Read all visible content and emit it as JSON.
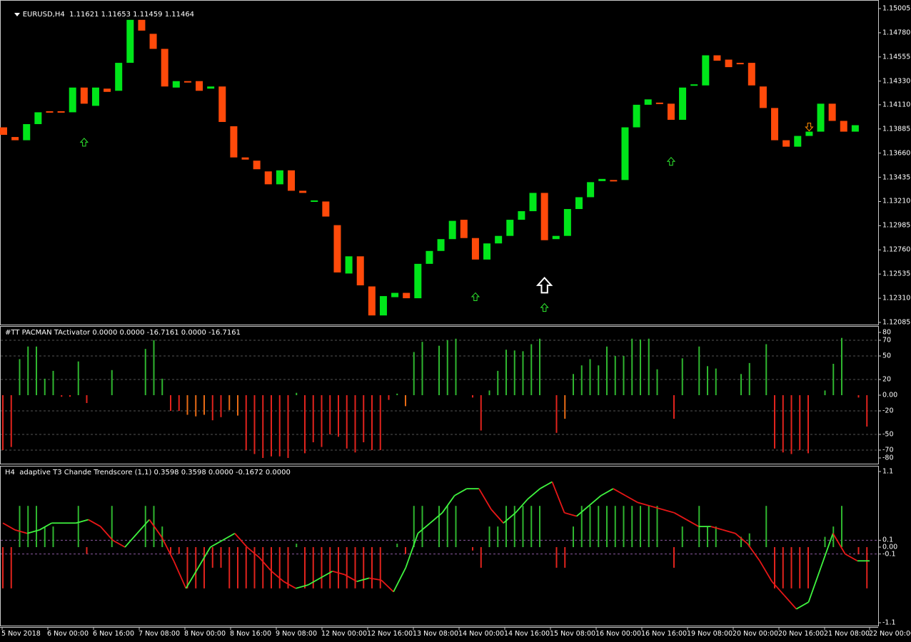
{
  "main_label": {
    "symbol": "EURUSD,H4",
    "ohlc": "1.11621 1.11653 1.11459 1.11464"
  },
  "pacman_label": "#TT PACMAN TActivator 0.0000 0.0000 -16.7161 0.0000 -16.7161",
  "t3_label": "H4  adaptive T3 Chande Trendscore (1,1) 0.3598 0.3598 0.0000 -0.1672 0.0000",
  "colors": {
    "bull": "#00e61a",
    "bear": "#ff4a0a",
    "hist_up": "#2fb62f",
    "hist_down": "#e1231d",
    "hist_orange": "#e86b15",
    "line_up": "#3ff43f",
    "line_down": "#e81717",
    "grid": "#2d2d2d",
    "pane_border": "#c8c8c8"
  },
  "price_axis_ticks": [
    "1.15005",
    "1.14780",
    "1.14555",
    "1.14330",
    "1.14110",
    "1.13885",
    "1.13660",
    "1.13435",
    "1.13210",
    "1.12985",
    "1.12760",
    "1.12535",
    "1.12310",
    "1.12085"
  ],
  "pacman_axis_ticks": [
    "80",
    "70",
    "50",
    "20",
    "0.00",
    "-20",
    "-50",
    "-70",
    "-80"
  ],
  "t3_axis_ticks": [
    "1.1",
    "0.1",
    "0.00",
    "-0.1",
    "-1.1"
  ],
  "time_axis_ticks": [
    "5 Nov 2018",
    "6 Nov 00:00",
    "6 Nov 16:00",
    "7 Nov 08:00",
    "8 Nov 00:00",
    "8 Nov 16:00",
    "9 Nov 08:00",
    "12 Nov 00:00",
    "12 Nov 16:00",
    "13 Nov 08:00",
    "14 Nov 00:00",
    "14 Nov 16:00",
    "15 Nov 08:00",
    "16 Nov 00:00",
    "16 Nov 16:00",
    "19 Nov 08:00",
    "20 Nov 00:00",
    "20 Nov 16:00",
    "21 Nov 08:00",
    "22 Nov 00:00"
  ],
  "chart_data": [
    {
      "type": "candlestick",
      "title": "EURUSD,H4",
      "ylim": [
        1.12085,
        1.15005
      ],
      "candles": [
        {
          "o": 1.139,
          "c": 1.1383
        },
        {
          "o": 1.1381,
          "c": 1.1378
        },
        {
          "o": 1.1378,
          "c": 1.1393
        },
        {
          "o": 1.1393,
          "c": 1.1404
        },
        {
          "o": 1.1405,
          "c": 1.1404
        },
        {
          "o": 1.1405,
          "c": 1.1404
        },
        {
          "o": 1.1404,
          "c": 1.1427
        },
        {
          "o": 1.1427,
          "c": 1.1412
        },
        {
          "o": 1.141,
          "c": 1.1427
        },
        {
          "o": 1.1426,
          "c": 1.1423
        },
        {
          "o": 1.1424,
          "c": 1.145
        },
        {
          "o": 1.145,
          "c": 1.149
        },
        {
          "o": 1.149,
          "c": 1.148
        },
        {
          "o": 1.1477,
          "c": 1.1463
        },
        {
          "o": 1.1463,
          "c": 1.1428
        },
        {
          "o": 1.1427,
          "c": 1.1433
        },
        {
          "o": 1.1433,
          "c": 1.1432
        },
        {
          "o": 1.1433,
          "c": 1.1424
        },
        {
          "o": 1.1426,
          "c": 1.1428
        },
        {
          "o": 1.1428,
          "c": 1.1395
        },
        {
          "o": 1.1391,
          "c": 1.1362
        },
        {
          "o": 1.1362,
          "c": 1.136
        },
        {
          "o": 1.1359,
          "c": 1.1351
        },
        {
          "o": 1.1349,
          "c": 1.1337
        },
        {
          "o": 1.1337,
          "c": 1.135
        },
        {
          "o": 1.135,
          "c": 1.1331
        },
        {
          "o": 1.1331,
          "c": 1.1329
        },
        {
          "o": 1.1321,
          "c": 1.1322
        },
        {
          "o": 1.1321,
          "c": 1.1307
        },
        {
          "o": 1.1299,
          "c": 1.1255
        },
        {
          "o": 1.1254,
          "c": 1.127
        },
        {
          "o": 1.127,
          "c": 1.1243
        },
        {
          "o": 1.1242,
          "c": 1.1215
        },
        {
          "o": 1.1215,
          "c": 1.1233
        },
        {
          "o": 1.1232,
          "c": 1.1236
        },
        {
          "o": 1.1236,
          "c": 1.1231
        },
        {
          "o": 1.1231,
          "c": 1.1263
        },
        {
          "o": 1.1263,
          "c": 1.1275
        },
        {
          "o": 1.1275,
          "c": 1.1286
        },
        {
          "o": 1.1286,
          "c": 1.1303
        },
        {
          "o": 1.1304,
          "c": 1.1287
        },
        {
          "o": 1.1287,
          "c": 1.1267
        },
        {
          "o": 1.1267,
          "c": 1.1282
        },
        {
          "o": 1.1282,
          "c": 1.1289
        },
        {
          "o": 1.1289,
          "c": 1.1304
        },
        {
          "o": 1.1304,
          "c": 1.1312
        },
        {
          "o": 1.1312,
          "c": 1.1329
        },
        {
          "o": 1.1329,
          "c": 1.1285
        },
        {
          "o": 1.1286,
          "c": 1.1289
        },
        {
          "o": 1.1289,
          "c": 1.1314
        },
        {
          "o": 1.1314,
          "c": 1.1325
        },
        {
          "o": 1.1325,
          "c": 1.1339
        },
        {
          "o": 1.134,
          "c": 1.1342
        },
        {
          "o": 1.1341,
          "c": 1.134
        },
        {
          "o": 1.1341,
          "c": 1.139
        },
        {
          "o": 1.139,
          "c": 1.1411
        },
        {
          "o": 1.1411,
          "c": 1.1416
        },
        {
          "o": 1.1413,
          "c": 1.1412
        },
        {
          "o": 1.1412,
          "c": 1.1397
        },
        {
          "o": 1.1397,
          "c": 1.1427
        },
        {
          "o": 1.1429,
          "c": 1.143
        },
        {
          "o": 1.1429,
          "c": 1.1457
        },
        {
          "o": 1.1457,
          "c": 1.1452
        },
        {
          "o": 1.1453,
          "c": 1.1446
        },
        {
          "o": 1.145,
          "c": 1.1449
        },
        {
          "o": 1.145,
          "c": 1.1429
        },
        {
          "o": 1.1428,
          "c": 1.1408
        },
        {
          "o": 1.1408,
          "c": 1.1378
        },
        {
          "o": 1.1378,
          "c": 1.1372
        },
        {
          "o": 1.1372,
          "c": 1.1382
        },
        {
          "o": 1.1382,
          "c": 1.1386
        },
        {
          "o": 1.1386,
          "c": 1.1412
        },
        {
          "o": 1.1412,
          "c": 1.1396
        },
        {
          "o": 1.1396,
          "c": 1.1386
        },
        {
          "o": 1.1386,
          "c": 1.1392
        }
      ],
      "arrows": [
        {
          "index": -1,
          "price": 1.13486,
          "dir": "up",
          "kind": "small"
        },
        {
          "index": 7,
          "price": 1.13798,
          "dir": "up",
          "kind": "small"
        },
        {
          "index": 41,
          "price": 1.1236,
          "dir": "up",
          "kind": "small"
        },
        {
          "index": 47,
          "price": 1.125,
          "dir": "up",
          "kind": "large"
        },
        {
          "index": 47,
          "price": 1.1226,
          "dir": "up",
          "kind": "small"
        },
        {
          "index": 58,
          "price": 1.1362,
          "dir": "up",
          "kind": "small"
        },
        {
          "index": 70,
          "price": 1.1394,
          "dir": "down",
          "kind": "small"
        }
      ]
    },
    {
      "type": "bar",
      "title": "#TT PACMAN TActivator",
      "ylim": [
        -80,
        80
      ],
      "values": [
        -70,
        -66,
        46,
        62,
        62,
        21,
        31,
        -2,
        -2,
        43,
        -10,
        0,
        0,
        32,
        0,
        0,
        0,
        59,
        70,
        21,
        -20,
        -20,
        -25,
        -27,
        -25,
        -32,
        -28,
        -19,
        -26,
        -70,
        -75,
        -80,
        -78,
        -78,
        -80,
        3,
        -74,
        -60,
        -66,
        -50,
        -53,
        -68,
        -73,
        -60,
        -70,
        -70,
        -6,
        2,
        -14,
        55,
        68,
        0,
        63,
        70,
        72,
        0,
        -3,
        -45,
        6,
        31,
        58,
        57,
        56,
        65,
        72,
        0,
        -48,
        -30,
        27,
        38,
        46,
        38,
        62,
        50,
        50,
        72,
        71,
        72,
        33,
        0,
        -30,
        47,
        0,
        62,
        37,
        34,
        0,
        0,
        27,
        41,
        0,
        65,
        -68,
        -73,
        -75,
        -70,
        -74,
        0,
        6,
        40,
        73,
        0,
        -3,
        -40
      ],
      "colors": [
        "d",
        "d",
        "u",
        "u",
        "u",
        "u",
        "u",
        "d",
        "d",
        "u",
        "d",
        "n",
        "n",
        "u",
        "n",
        "n",
        "n",
        "u",
        "u",
        "u",
        "d",
        "d",
        "o",
        "o",
        "o",
        "d",
        "d",
        "o",
        "o",
        "d",
        "d",
        "d",
        "d",
        "d",
        "d",
        "u",
        "d",
        "d",
        "d",
        "d",
        "d",
        "d",
        "d",
        "d",
        "d",
        "d",
        "d",
        "u",
        "o",
        "u",
        "u",
        "n",
        "u",
        "u",
        "u",
        "n",
        "d",
        "d",
        "u",
        "u",
        "u",
        "u",
        "u",
        "u",
        "u",
        "n",
        "d",
        "o",
        "u",
        "u",
        "u",
        "u",
        "u",
        "u",
        "u",
        "u",
        "u",
        "u",
        "u",
        "n",
        "d",
        "u",
        "n",
        "u",
        "u",
        "u",
        "n",
        "n",
        "u",
        "u",
        "n",
        "u",
        "d",
        "d",
        "d",
        "d",
        "d",
        "n",
        "u",
        "u",
        "u",
        "n",
        "d",
        "d"
      ]
    },
    {
      "type": "bar+line",
      "title": "adaptive T3 Chande Trendscore (1,1)",
      "ylim": [
        -1.1,
        1.1
      ],
      "hist": [
        -0.6,
        -0.6,
        0.6,
        0.6,
        0.6,
        0.3,
        0.3,
        0,
        0,
        0.6,
        -0.1,
        0,
        0,
        0.6,
        0,
        0,
        0,
        0.6,
        0.6,
        0.3,
        -0.1,
        -0.1,
        -0.6,
        -0.6,
        -0.6,
        -0.3,
        -0.3,
        -0.6,
        -0.6,
        -0.6,
        -0.6,
        -0.6,
        -0.6,
        -0.6,
        -0.6,
        0.05,
        -0.6,
        -0.6,
        -0.6,
        -0.6,
        -0.6,
        -0.6,
        -0.6,
        -0.6,
        -0.6,
        -0.6,
        0,
        0.05,
        -0.1,
        0.6,
        0.6,
        0,
        0.6,
        0.6,
        0.6,
        0,
        -0.05,
        -0.3,
        0.3,
        0.3,
        0.6,
        0.6,
        0.6,
        0.6,
        0.6,
        0,
        -0.3,
        -0.3,
        0.3,
        0.6,
        0.6,
        0.6,
        0.6,
        0.6,
        0.6,
        0.6,
        0.6,
        0.6,
        0.6,
        0,
        -0.3,
        0.3,
        0,
        0.6,
        0.3,
        0.3,
        0,
        0,
        0.15,
        0.2,
        0,
        0.6,
        -0.6,
        -0.6,
        -0.6,
        -0.6,
        -0.6,
        0,
        0.15,
        0.3,
        0.6,
        0,
        -0.1,
        -0.6
      ],
      "line": [
        0.35,
        0.25,
        0.2,
        0.25,
        0.35,
        0.35,
        0.35,
        0.4,
        0.3,
        0.1,
        0.0,
        0.2,
        0.4,
        0.15,
        -0.2,
        -0.6,
        -0.3,
        0.0,
        0.1,
        0.2,
        0.0,
        -0.15,
        -0.35,
        -0.5,
        -0.6,
        -0.55,
        -0.45,
        -0.35,
        -0.4,
        -0.5,
        -0.45,
        -0.48,
        -0.65,
        -0.3,
        0.2,
        0.35,
        0.5,
        0.75,
        0.85,
        0.85,
        0.55,
        0.35,
        0.5,
        0.7,
        0.85,
        0.95,
        0.5,
        0.45,
        0.6,
        0.75,
        0.85,
        0.75,
        0.65,
        0.6,
        0.55,
        0.5,
        0.4,
        0.3,
        0.3,
        0.25,
        0.2,
        0.05,
        -0.2,
        -0.5,
        -0.7,
        -0.9,
        -0.8,
        -0.3,
        0.2,
        -0.1,
        -0.2,
        -0.2
      ]
    }
  ]
}
